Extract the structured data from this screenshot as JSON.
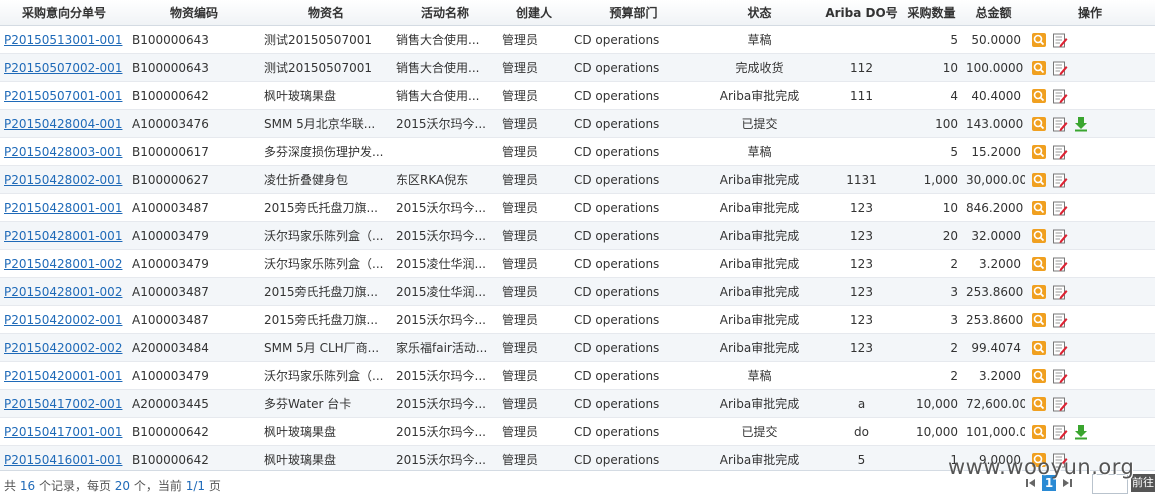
{
  "columns": [
    "采购意向分单号",
    "物资编码",
    "物资名",
    "活动名称",
    "创建人",
    "预算部门",
    "状态",
    "Ariba DO号",
    "采购数量",
    "总金额",
    "操作"
  ],
  "rows": [
    {
      "code": "P20150513001-001",
      "material_code": "B100000643",
      "material_name": "测试20150507001",
      "activity": "销售大合使用...",
      "creator": "管理员",
      "dept": "CD operations",
      "status": "草稿",
      "ariba_do": "",
      "qty": "5",
      "amount": "50.0000",
      "download": false
    },
    {
      "code": "P20150507002-001",
      "material_code": "B100000643",
      "material_name": "测试20150507001",
      "activity": "销售大合使用...",
      "creator": "管理员",
      "dept": "CD operations",
      "status": "完成收货",
      "ariba_do": "112",
      "qty": "10",
      "amount": "100.0000",
      "download": false
    },
    {
      "code": "P20150507001-001",
      "material_code": "B100000642",
      "material_name": "枫叶玻璃果盘",
      "activity": "销售大合使用...",
      "creator": "管理员",
      "dept": "CD operations",
      "status": "Ariba审批完成",
      "ariba_do": "111",
      "qty": "4",
      "amount": "40.4000",
      "download": false
    },
    {
      "code": "P20150428004-001",
      "material_code": "A100003476",
      "material_name": "SMM 5月北京华联...",
      "activity": "2015沃尔玛今...",
      "creator": "管理员",
      "dept": "CD operations",
      "status": "已提交",
      "ariba_do": "",
      "qty": "100",
      "amount": "143.0000",
      "download": true
    },
    {
      "code": "P20150428003-001",
      "material_code": "B100000617",
      "material_name": "多芬深度损伤理护发...",
      "activity": "",
      "creator": "管理员",
      "dept": "CD operations",
      "status": "草稿",
      "ariba_do": "",
      "qty": "5",
      "amount": "15.2000",
      "download": false
    },
    {
      "code": "P20150428002-001",
      "material_code": "B100000627",
      "material_name": "凌仕折叠健身包",
      "activity": "东区RKA倪东",
      "creator": "管理员",
      "dept": "CD operations",
      "status": "Ariba审批完成",
      "ariba_do": "1131",
      "qty": "1,000",
      "amount": "30,000.0000",
      "download": false
    },
    {
      "code": "P20150428001-001",
      "material_code": "A100003487",
      "material_name": "2015旁氏托盘刀旗...",
      "activity": "2015沃尔玛今...",
      "creator": "管理员",
      "dept": "CD operations",
      "status": "Ariba审批完成",
      "ariba_do": "123",
      "qty": "10",
      "amount": "846.2000",
      "download": false
    },
    {
      "code": "P20150428001-001",
      "material_code": "A100003479",
      "material_name": "沃尔玛家乐陈列盒（...",
      "activity": "2015沃尔玛今...",
      "creator": "管理员",
      "dept": "CD operations",
      "status": "Ariba审批完成",
      "ariba_do": "123",
      "qty": "20",
      "amount": "32.0000",
      "download": false
    },
    {
      "code": "P20150428001-002",
      "material_code": "A100003479",
      "material_name": "沃尔玛家乐陈列盒（...",
      "activity": "2015凌仕华润...",
      "creator": "管理员",
      "dept": "CD operations",
      "status": "Ariba审批完成",
      "ariba_do": "123",
      "qty": "2",
      "amount": "3.2000",
      "download": false
    },
    {
      "code": "P20150428001-002",
      "material_code": "A100003487",
      "material_name": "2015旁氏托盘刀旗...",
      "activity": "2015凌仕华润...",
      "creator": "管理员",
      "dept": "CD operations",
      "status": "Ariba审批完成",
      "ariba_do": "123",
      "qty": "3",
      "amount": "253.8600",
      "download": false
    },
    {
      "code": "P20150420002-001",
      "material_code": "A100003487",
      "material_name": "2015旁氏托盘刀旗...",
      "activity": "2015沃尔玛今...",
      "creator": "管理员",
      "dept": "CD operations",
      "status": "Ariba审批完成",
      "ariba_do": "123",
      "qty": "3",
      "amount": "253.8600",
      "download": false
    },
    {
      "code": "P20150420002-002",
      "material_code": "A200003484",
      "material_name": "SMM 5月 CLH厂商...",
      "activity": "家乐福fair活动...",
      "creator": "管理员",
      "dept": "CD operations",
      "status": "Ariba审批完成",
      "ariba_do": "123",
      "qty": "2",
      "amount": "99.4074",
      "download": false
    },
    {
      "code": "P20150420001-001",
      "material_code": "A100003479",
      "material_name": "沃尔玛家乐陈列盒（...",
      "activity": "2015沃尔玛今...",
      "creator": "管理员",
      "dept": "CD operations",
      "status": "草稿",
      "ariba_do": "",
      "qty": "2",
      "amount": "3.2000",
      "download": false
    },
    {
      "code": "P20150417002-001",
      "material_code": "A200003445",
      "material_name": "多芬Water 台卡",
      "activity": "2015沃尔玛今...",
      "creator": "管理员",
      "dept": "CD operations",
      "status": "Ariba审批完成",
      "ariba_do": "a",
      "qty": "10,000",
      "amount": "72,600.0000",
      "download": false
    },
    {
      "code": "P20150417001-001",
      "material_code": "B100000642",
      "material_name": "枫叶玻璃果盘",
      "activity": "2015沃尔玛今...",
      "creator": "管理员",
      "dept": "CD operations",
      "status": "已提交",
      "ariba_do": "do",
      "qty": "10,000",
      "amount": "101,000.0000",
      "download": true
    },
    {
      "code": "P20150416001-001",
      "material_code": "B100000642",
      "material_name": "枫叶玻璃果盘",
      "activity": "2015沃尔玛今...",
      "creator": "管理员",
      "dept": "CD operations",
      "status": "Ariba审批完成",
      "ariba_do": "5",
      "qty": "1",
      "amount": "9.0000",
      "download": false
    }
  ],
  "footer": {
    "prefix": "共",
    "total": "16",
    "mid1": "个记录，每页",
    "per_page": "20",
    "mid2": "个，当前",
    "page": "1/1",
    "suffix": "页"
  },
  "pager": {
    "current": "1",
    "prev_label": "前往"
  },
  "watermark": "www.wooyun.org",
  "icons": {
    "view": "search-icon",
    "edit": "edit-icon",
    "download": "download-icon"
  },
  "colors": {
    "link": "#1f6ab8",
    "header_bg": "#f0f3f6",
    "alt_row": "#f3f6f9",
    "pager_current": "#2a8ad4",
    "download": "#3aa52f",
    "view": "#f0a020"
  }
}
